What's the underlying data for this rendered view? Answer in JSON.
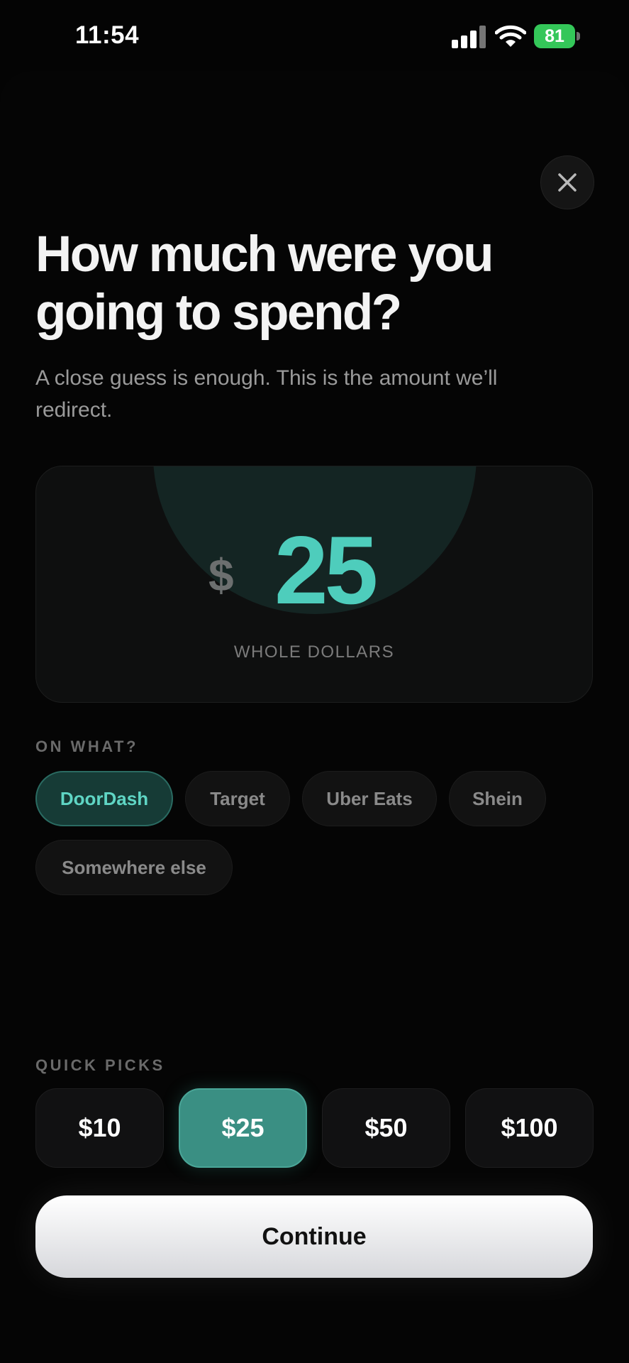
{
  "status_bar": {
    "time": "11:54",
    "battery_level": "81",
    "icons": [
      "signal-icon",
      "wifi-icon",
      "battery-charging-icon"
    ]
  },
  "sheet": {
    "close_icon": "close-icon",
    "title": "How much were you going to spend?",
    "subtitle": "A close guess is enough. This is the amount we’ll redirect."
  },
  "amount": {
    "currency": "$",
    "value": "25",
    "caption": "WHOLE DOLLARS"
  },
  "category": {
    "label": "ON WHAT?",
    "selected": "DoorDash",
    "options": [
      "DoorDash",
      "Target",
      "Uber Eats",
      "Shein",
      "Somewhere else"
    ]
  },
  "quick_picks": {
    "label": "QUICK PICKS",
    "selected": "$25",
    "options": [
      "$10",
      "$25",
      "$50",
      "$100"
    ]
  },
  "continue_label": "Continue",
  "colors": {
    "accent": "#4ecdbc",
    "selected_chip_bg": "#163b36",
    "selected_pick_bg": "#3a8f83",
    "background": "#040404",
    "battery": "#34c759"
  }
}
